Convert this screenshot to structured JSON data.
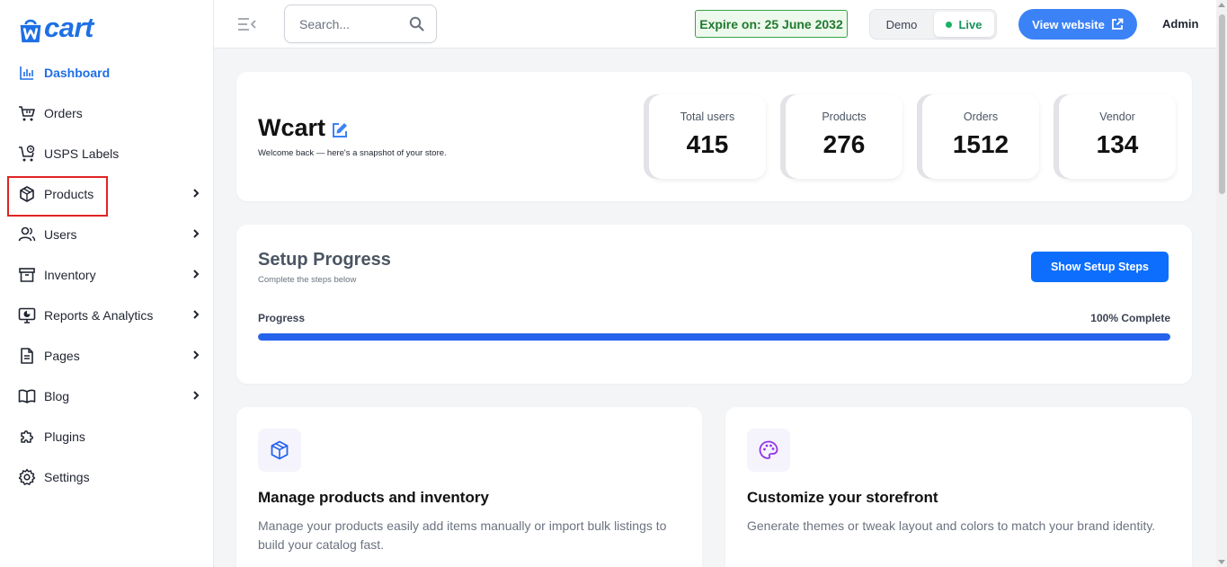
{
  "brand": {
    "logo_text": "cart",
    "primary_color": "#1f6fe5"
  },
  "sidebar": {
    "items": [
      {
        "label": "Dashboard",
        "icon": "bar-chart-icon",
        "active": true
      },
      {
        "label": "Orders",
        "icon": "cart-icon"
      },
      {
        "label": "USPS Labels",
        "icon": "shipping-cart-icon"
      },
      {
        "label": "Products",
        "icon": "box-icon",
        "has_submenu": true,
        "highlighted": true
      },
      {
        "label": "Users",
        "icon": "users-icon",
        "has_submenu": true
      },
      {
        "label": "Inventory",
        "icon": "archive-icon",
        "has_submenu": true
      },
      {
        "label": "Reports & Analytics",
        "icon": "analytics-icon",
        "has_submenu": true
      },
      {
        "label": "Pages",
        "icon": "document-icon",
        "has_submenu": true
      },
      {
        "label": "Blog",
        "icon": "book-icon",
        "has_submenu": true
      },
      {
        "label": "Plugins",
        "icon": "puzzle-icon"
      },
      {
        "label": "Settings",
        "icon": "gear-icon"
      }
    ]
  },
  "header": {
    "search_placeholder": "Search...",
    "expire_text": "Expire on: 25 June 2032",
    "mode_demo": "Demo",
    "mode_live": "Live",
    "view_website": "View website",
    "user": "Admin"
  },
  "welcome": {
    "store_name": "Wcart",
    "subtitle": "Welcome back — here's a snapshot of your store.",
    "stats": [
      {
        "label": "Total users",
        "value": "415"
      },
      {
        "label": "Products",
        "value": "276"
      },
      {
        "label": "Orders",
        "value": "1512"
      },
      {
        "label": "Vendor",
        "value": "134"
      }
    ]
  },
  "setup": {
    "title": "Setup Progress",
    "subtitle": "Complete the steps below",
    "button": "Show Setup Steps",
    "progress_label": "Progress",
    "progress_text": "100% Complete",
    "progress_percent": 100
  },
  "features": [
    {
      "icon": "box-icon",
      "title": "Manage products and inventory",
      "description": "Manage your products easily add items manually or import bulk listings to build your catalog fast."
    },
    {
      "icon": "palette-icon",
      "title": "Customize your storefront",
      "description": "Generate themes or tweak layout and colors to match your brand identity."
    }
  ]
}
